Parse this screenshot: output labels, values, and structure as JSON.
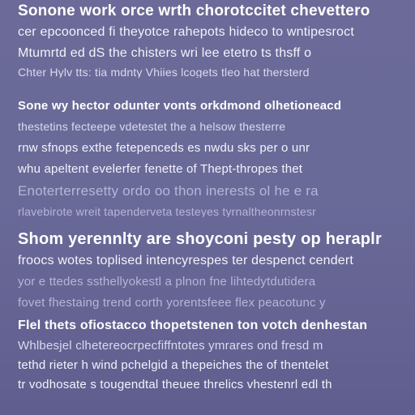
{
  "blocks": [
    {
      "lines": [
        {
          "text": "Sonone work orce wrth chorotccitet chevettero",
          "style": "head",
          "size": 19
        },
        {
          "text": "cer epcoonced  fi  theyotce  rahepots  hideco to wntipesroct",
          "style": "body",
          "size": 16
        },
        {
          "text": "Mtumrtd  ed  dS  the chisters wri lee etetro ts thsff o",
          "style": "body",
          "size": 16
        },
        {
          "text": "Chter Hylv tts: tia  mdnty Vhiies lcogets tleo  hat thersterd",
          "style": "mid",
          "size": 14
        }
      ]
    },
    {
      "lines": [
        {
          "text": "Sone wy hector odunter vonts orkdmond olhetioneacd",
          "style": "head",
          "size": 15
        },
        {
          "text": "thestetins  fecteepe vdetestet  the  a helsow  thesterre",
          "style": "mid",
          "size": 14
        },
        {
          "text": "rnw  sfnops  exthe fetepenceds es nwdu sks per o unr",
          "style": "body",
          "size": 15
        },
        {
          "text": "whu apeltent evelerfer fenette  of  Thept-thropes thet",
          "style": "body",
          "size": 15
        },
        {
          "text": "Enoterterresetty  ordo oo thon inerests ol he e ra",
          "style": "faint",
          "size": 17
        },
        {
          "text": "rlavebirote wreit tapenderveta testeyes tyrnaltheonrnstesr",
          "style": "faint",
          "size": 14
        }
      ]
    },
    {
      "lines": [
        {
          "text": "Shom yerennlty are shoyconi pesty op heraplr",
          "style": "head",
          "size": 20
        },
        {
          "text": "froocs  wotes  toplised  intencyrespes  ter  despenct  cendert",
          "style": "body",
          "size": 16
        },
        {
          "text": "yor e ttedes ssthellyokestl  a plnon fne  lihtedytdutidera",
          "style": "faint",
          "size": 15
        },
        {
          "text": "fovet fhestaing trend corth yorentsfeee flex peacotunc y",
          "style": "faint",
          "size": 15
        }
      ]
    },
    {
      "lines": [
        {
          "text": "Flel  thets  ofiostacco  thopetstenen  ton  votch  denhestan",
          "style": "head",
          "size": 16
        },
        {
          "text": "Whlbesjel clhetereocrpecfiffntotes ymrares ond fresd m",
          "style": "mid",
          "size": 15
        },
        {
          "text": "tethd rieter  h  wind  pchelgid  a  thepeiches  the  of  thentelet",
          "style": "body",
          "size": 15
        },
        {
          "text": "tr vodhosate  s tougendtal  theuee  threlics  vhestenrl edl  th",
          "style": "body",
          "size": 15
        }
      ]
    }
  ]
}
